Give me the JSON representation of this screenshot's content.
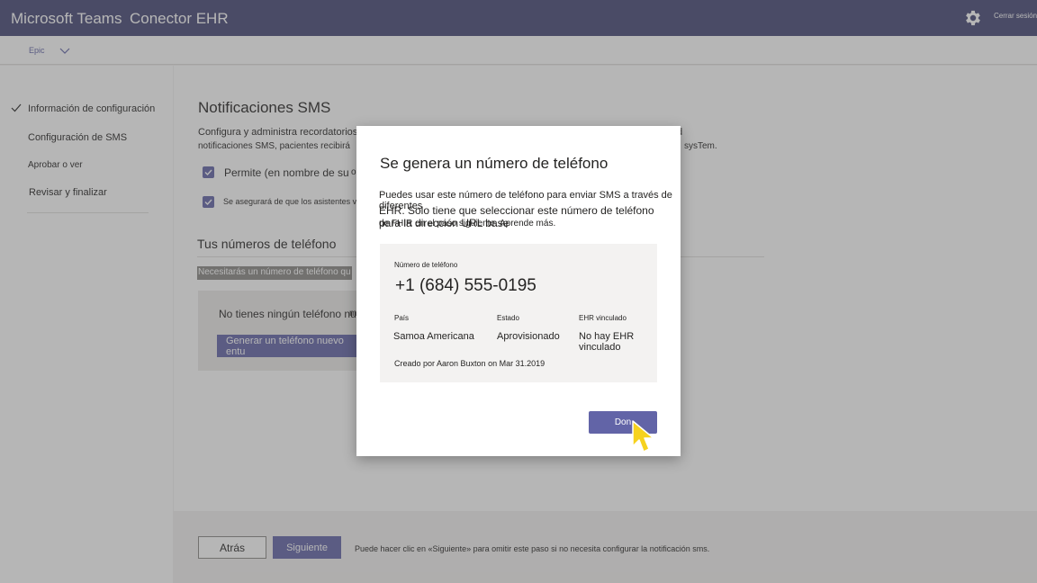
{
  "header": {
    "app_title": "Microsoft Teams",
    "connector_title": "Conector EHR",
    "settings_icon": "gear-icon",
    "sign_out": "Cerrar sesión",
    "bar_color": "#464775"
  },
  "subheader": {
    "ehr_label": "Epic",
    "dropdown_icon": "chevron-down-icon"
  },
  "sidebar": {
    "items": [
      {
        "label": "Información de configuración",
        "completed": true
      },
      {
        "label": "Configuración de SMS",
        "completed": false
      },
      {
        "label": "Aprobar o ver",
        "completed": false
      },
      {
        "label": "Revisar y finalizar",
        "completed": false
      }
    ]
  },
  "main": {
    "title": "Notificaciones SMS",
    "description_line1": "Configura y administra recordatorios de",
    "description_line1_right": "d",
    "description_line2": "notificaciones SMS, pacientes recibirá",
    "description_line2_right": "sysTem.",
    "checkbox1_label": "Permite (en nombre de su",
    "checkbox1_tail": "o",
    "checkbox1_checked": true,
    "checkbox2_label": "Se asegurará de que los asistentes vengan",
    "checkbox2_checked": true,
    "phones_title": "Tus números de teléfono",
    "need_phone_text": "Necesitarás un número de teléfono qu",
    "no_phone_text": "No tienes ningún teléfono nu",
    "no_phone_tail": "m",
    "generate_button": "Generar un teléfono nuevo entu"
  },
  "footer": {
    "back_button": "Atrás",
    "next_button": "Siguiente",
    "note": "Puede hacer clic en «Siguiente» para omitir este paso si no necesita configurar la notificación sms."
  },
  "dialog": {
    "title": "Se genera un número de teléfono",
    "text_line1": "Puedes usar este número de teléfono para enviar SMS a través de diferentes",
    "text_line2": "EHR. Solo tiene que seleccionar este número de teléfono para la dirección URL base",
    "text_line3": "de FHIR en el paso siguiente. Aprende más.",
    "card": {
      "phone_label": "Número de teléfono",
      "phone_number": "+1 (684) 555-0195",
      "country_label": "País",
      "country_value": "Samoa Americana",
      "status_label": "Estado",
      "status_value": "Aprovisionado",
      "ehr_label": "EHR vinculado",
      "ehr_value": "No hay EHR vinculado",
      "created": "Creado por Aaron Buxton on Mar 31.2019"
    },
    "done_button": "Don",
    "accent_color": "#6264a7"
  }
}
